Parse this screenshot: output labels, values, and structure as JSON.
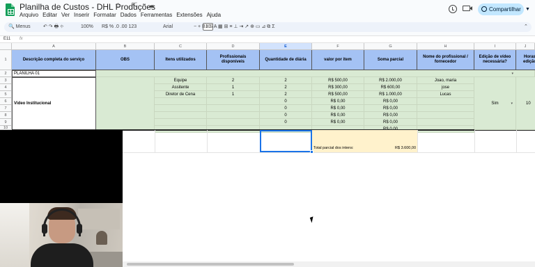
{
  "app": {
    "title": "Planilha de Custos - DHL Produções",
    "menu": [
      "Arquivo",
      "Editar",
      "Ver",
      "Inserir",
      "Formatar",
      "Dados",
      "Ferramentas",
      "Extensões",
      "Ajuda"
    ],
    "share_label": "Compartilhar"
  },
  "toolbar": {
    "menus_label": "Menus",
    "zoom": "100%",
    "font": "Arial",
    "font_size": "10",
    "icons": "↶  ↷  🖶  ⌖",
    "format_icons": "R$   %   .0   .00   123",
    "text_icons": "−        +    B   I   S   A   ▦   ⊞   ≡   ⊥   ⇥   ↗   ⊕   ▭   ⊿   ⧉   Σ"
  },
  "formula_bar": {
    "name_box": "E11",
    "fx": "fx"
  },
  "columns": [
    "A",
    "B",
    "C",
    "D",
    "E",
    "F",
    "G",
    "H",
    "I",
    "J"
  ],
  "rows": [
    "1",
    "2",
    "3",
    "4",
    "5",
    "6",
    "7",
    "8",
    "9",
    "10"
  ],
  "headers": {
    "a": "Descrição completa do serviço",
    "b": "OBS",
    "c": "Itens utilizados",
    "d": "Profissionais disponíveis",
    "e": "Quantidade de diária",
    "f": "valor por item",
    "g": "Soma parcial",
    "h": "Nome do profissional / fornecedor",
    "i": "Edição de vídeo necessária?",
    "j": "Horas edição"
  },
  "sheet_label": "PLANILHA 01",
  "service_label": "Vídeo Institucional",
  "items": [
    {
      "item": "Equipe",
      "pros": "2",
      "days": "2",
      "unit": "R$ 500,00",
      "sum": "R$ 2.000,00",
      "name": "Joao, maria"
    },
    {
      "item": "Assitente",
      "pros": "1",
      "days": "2",
      "unit": "R$ 300,00",
      "sum": "R$ 600,00",
      "name": "jose"
    },
    {
      "item": "Diretor de Cena",
      "pros": "1",
      "days": "2",
      "unit": "R$ 500,00",
      "sum": "R$ 1.000,00",
      "name": "Lucas"
    },
    {
      "item": "",
      "pros": "",
      "days": "0",
      "unit": "R$ 0,00",
      "sum": "R$ 0,00",
      "name": ""
    },
    {
      "item": "",
      "pros": "",
      "days": "0",
      "unit": "R$ 0,00",
      "sum": "R$ 0,00",
      "name": ""
    },
    {
      "item": "",
      "pros": "",
      "days": "0",
      "unit": "R$ 0,00",
      "sum": "R$ 0,00",
      "name": ""
    },
    {
      "item": "",
      "pros": "",
      "days": "0",
      "unit": "R$ 0,00",
      "sum": "R$ 0,00",
      "name": ""
    },
    {
      "item": "",
      "pros": "",
      "days": "",
      "unit": "",
      "sum": "R$ 0,00",
      "name": ""
    }
  ],
  "edit_needed": "Sim",
  "edit_hours": "10",
  "total_label": "Total parcial dos intens:",
  "total_value": "R$ 3.600,00"
}
